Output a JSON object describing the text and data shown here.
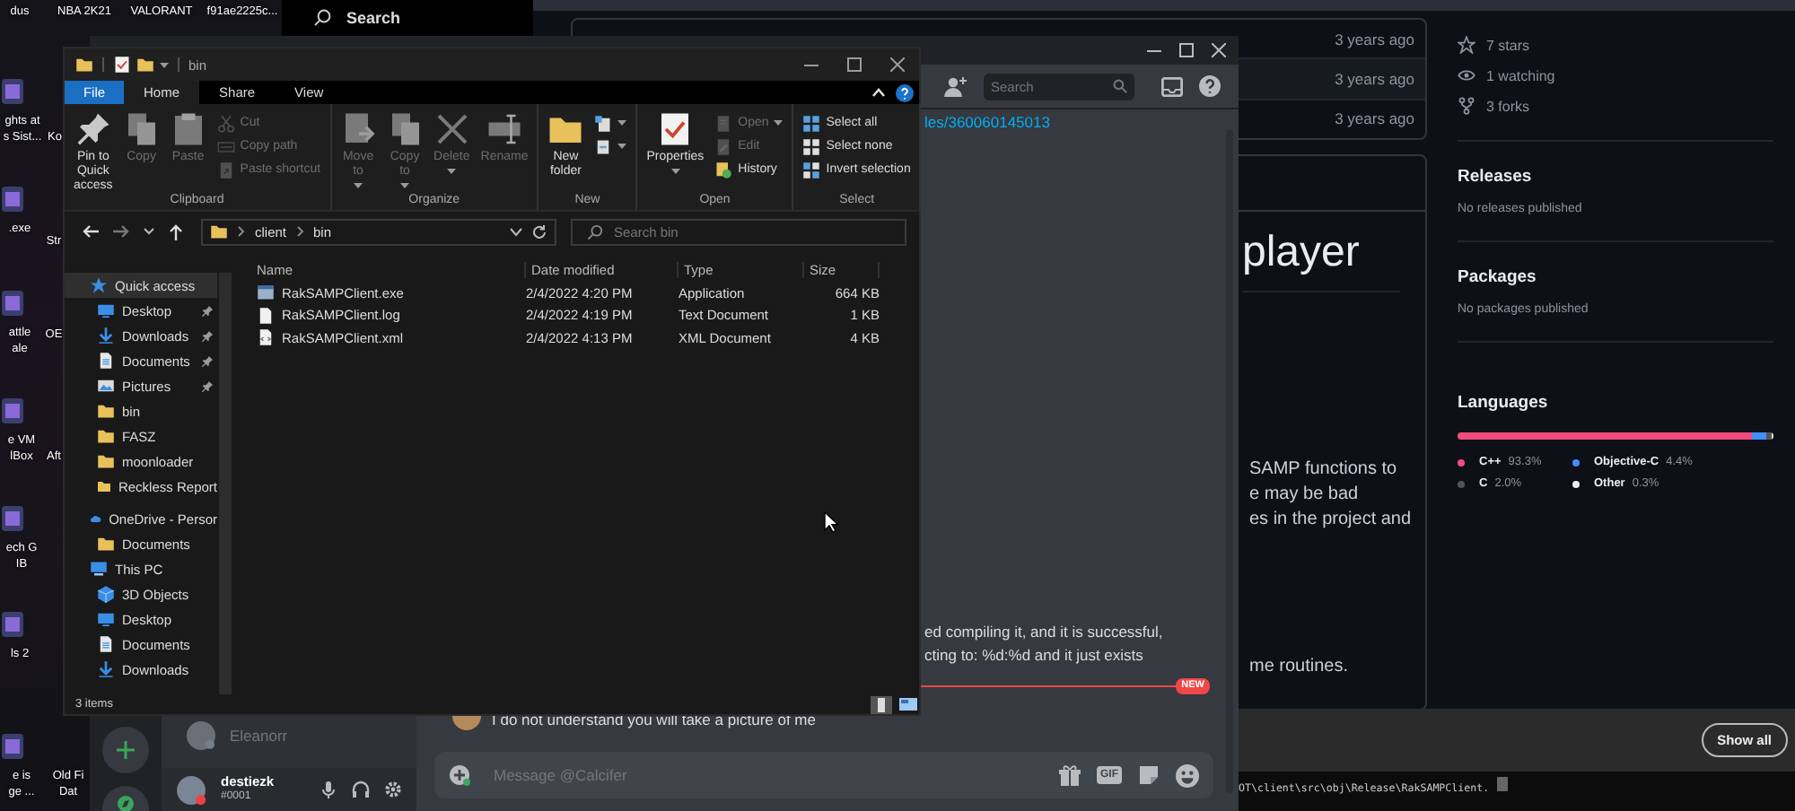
{
  "desktop": {
    "icons": [
      {
        "lines": [
          "dus"
        ]
      },
      {
        "lines": [
          "NBA 2K21"
        ]
      },
      {
        "lines": [
          "VALORANT"
        ]
      },
      {
        "lines": [
          "f91ae2225c..."
        ]
      },
      {
        "lines": [
          "ghts at",
          "s Sist..."
        ]
      },
      {
        "lines": [
          "Ko"
        ]
      },
      {
        "lines": [
          ".exe"
        ]
      },
      {
        "lines": [
          "Str"
        ]
      },
      {
        "lines": [
          "attle",
          "ale"
        ]
      },
      {
        "lines": [
          "OE"
        ]
      },
      {
        "lines": [
          "e VM",
          "lBox"
        ]
      },
      {
        "lines": [
          "Aft"
        ]
      },
      {
        "lines": [
          "ech G",
          "IB"
        ]
      },
      {
        "lines": [
          "ls 2"
        ]
      },
      {
        "lines": [
          "e is",
          "ge ..."
        ]
      },
      {
        "lines": [
          "Old Fi",
          "Dat"
        ]
      }
    ]
  },
  "start_search": {
    "placeholder": "Search"
  },
  "github": {
    "commit_times": [
      "3 years ago",
      "3 years ago",
      "3 years ago"
    ],
    "readme": {
      "heading": "player",
      "lines": [
        "SAMP functions to",
        "e may be bad",
        "es in the project and"
      ],
      "last_line": "me routines."
    },
    "about": [
      {
        "kind": "star",
        "text": "7 stars"
      },
      {
        "kind": "eye",
        "text": "1 watching"
      },
      {
        "kind": "fork",
        "text": "3 forks"
      }
    ],
    "releases": {
      "title": "Releases",
      "text": "No releases published"
    },
    "packages": {
      "title": "Packages",
      "text": "No packages published"
    },
    "languages": {
      "title": "Languages",
      "items": [
        {
          "name": "C++",
          "percent": "93.3%",
          "color": "#f34b7d",
          "level": 0.933
        },
        {
          "name": "Objective-C",
          "percent": "4.4%",
          "color": "#438eff",
          "level": 0.044
        },
        {
          "name": "C",
          "percent": "2.0%",
          "color": "#555555",
          "level": 0.02
        },
        {
          "name": "Other",
          "percent": "0.3%",
          "color": "#ededed",
          "level": 0.003
        }
      ]
    }
  },
  "notification": {
    "button": "Show all"
  },
  "terminal": {
    "line": "OT\\client\\src\\obj\\Release\\RakSAMPClient."
  },
  "discord": {
    "search": {
      "placeholder": "Search"
    },
    "link": "les/360060145013",
    "message_lines": [
      "ed compiling it, and it is successful,",
      "cting to: %d:%d and it just exists"
    ],
    "new_divider": "NEW",
    "last_message": "I do not understand you will take a picture of me",
    "input": {
      "placeholder": "Message @Calcifer"
    },
    "input_buttons": [
      {
        "kind": "gift"
      },
      {
        "kind": "gif",
        "text": "GIF"
      },
      {
        "kind": "sticker"
      },
      {
        "kind": "emoji"
      }
    ],
    "dm": {
      "name": "Eleanorr"
    },
    "user": {
      "name": "destiezk",
      "tag": "#0001"
    }
  },
  "explorer": {
    "title": "bin",
    "tabs": [
      {
        "label": "File",
        "kind": "file",
        "selected": false
      },
      {
        "label": "Home",
        "kind": "tab",
        "selected": true
      },
      {
        "label": "Share",
        "kind": "tab",
        "selected": false
      },
      {
        "label": "View",
        "kind": "tab",
        "selected": false
      }
    ],
    "ribbon": [
      {
        "group": "Clipboard",
        "items": [
          {
            "kind": "large",
            "label": "Pin to Quick access",
            "disabled": false,
            "dropdown": false
          },
          {
            "kind": "large",
            "label": "Copy",
            "disabled": true,
            "dropdown": false
          },
          {
            "kind": "large",
            "label": "Paste",
            "disabled": true,
            "dropdown": false
          },
          {
            "kind": "stack",
            "items": [
              {
                "label": "Cut",
                "disabled": true,
                "dropdown": false
              },
              {
                "label": "Copy path",
                "disabled": true,
                "dropdown": false
              },
              {
                "label": "Paste shortcut",
                "disabled": true,
                "dropdown": false
              }
            ]
          }
        ]
      },
      {
        "group": "Organize",
        "items": [
          {
            "kind": "large",
            "label": "Move to",
            "disabled": true,
            "dropdown": true
          },
          {
            "kind": "large",
            "label": "Copy to",
            "disabled": true,
            "dropdown": true
          },
          {
            "kind": "large",
            "label": "Delete",
            "disabled": true,
            "dropdown": true
          },
          {
            "kind": "large",
            "label": "Rename",
            "disabled": true,
            "dropdown": false
          }
        ]
      },
      {
        "group": "New",
        "items": [
          {
            "kind": "large",
            "label": "New folder",
            "disabled": false,
            "dropdown": false
          },
          {
            "kind": "stack",
            "items": [
              {
                "disabled": false,
                "dropdown": true
              },
              {
                "disabled": false,
                "dropdown": true
              }
            ]
          }
        ]
      },
      {
        "group": "Open",
        "items": [
          {
            "kind": "large",
            "label": "Properties",
            "disabled": false,
            "dropdown": true
          },
          {
            "kind": "stack",
            "items": [
              {
                "label": "Open",
                "disabled": true,
                "dropdown": true
              },
              {
                "label": "Edit",
                "disabled": true,
                "dropdown": false
              },
              {
                "label": "History",
                "disabled": false,
                "dropdown": false
              }
            ]
          }
        ]
      },
      {
        "group": "Select",
        "items": [
          {
            "kind": "stack",
            "items": [
              {
                "label": "Select all",
                "disabled": false,
                "dropdown": false
              },
              {
                "label": "Select none",
                "disabled": false,
                "dropdown": false
              },
              {
                "label": "Invert selection",
                "disabled": false,
                "dropdown": false
              }
            ]
          }
        ]
      }
    ],
    "path": [
      "client",
      "bin"
    ],
    "search": {
      "placeholder": "Search bin"
    },
    "nav": [
      {
        "label": "Quick access",
        "kind": "star",
        "selected": true,
        "children": [
          {
            "label": "Desktop",
            "kind": "desktop",
            "pinned": true,
            "selected": false
          },
          {
            "label": "Downloads",
            "kind": "downloads",
            "pinned": true,
            "selected": false
          },
          {
            "label": "Documents",
            "kind": "documents",
            "pinned": true,
            "selected": false
          },
          {
            "label": "Pictures",
            "kind": "pictures",
            "pinned": true,
            "selected": false
          },
          {
            "label": "bin",
            "kind": "folder",
            "pinned": false,
            "selected": false
          },
          {
            "label": "FASZ",
            "kind": "folder",
            "pinned": false,
            "selected": false
          },
          {
            "label": "moonloader",
            "kind": "folder",
            "pinned": false,
            "selected": false
          },
          {
            "label": "Reckless Report",
            "kind": "folder",
            "pinned": false,
            "selected": false
          }
        ]
      },
      {
        "label": "OneDrive - Persor",
        "kind": "cloud",
        "selected": false,
        "children": [
          {
            "label": "Documents",
            "kind": "folder",
            "pinned": false,
            "selected": false
          }
        ]
      },
      {
        "label": "This PC",
        "kind": "pc",
        "selected": false,
        "children": [
          {
            "label": "3D Objects",
            "kind": "cube",
            "pinned": false,
            "selected": false
          },
          {
            "label": "Desktop",
            "kind": "desktop",
            "pinned": false,
            "selected": false
          },
          {
            "label": "Documents",
            "kind": "documents",
            "pinned": false,
            "selected": false
          },
          {
            "label": "Downloads",
            "kind": "downloads",
            "pinned": false,
            "selected": false
          }
        ]
      }
    ],
    "columns": [
      "Name",
      "Date modified",
      "Type",
      "Size"
    ],
    "files": [
      {
        "name": "RakSAMPClient.exe",
        "kind": "exe",
        "date": "2/4/2022 4:20 PM",
        "type": "Application",
        "size": "664 KB"
      },
      {
        "name": "RakSAMPClient.log",
        "kind": "log",
        "date": "2/4/2022 4:19 PM",
        "type": "Text Document",
        "size": "1 KB"
      },
      {
        "name": "RakSAMPClient.xml",
        "kind": "xml",
        "date": "2/4/2022 4:13 PM",
        "type": "XML Document",
        "size": "4 KB"
      }
    ],
    "status": "3 items",
    "views": [
      {
        "kind": "details",
        "selected": true
      },
      {
        "kind": "tiles",
        "selected": false
      }
    ]
  }
}
